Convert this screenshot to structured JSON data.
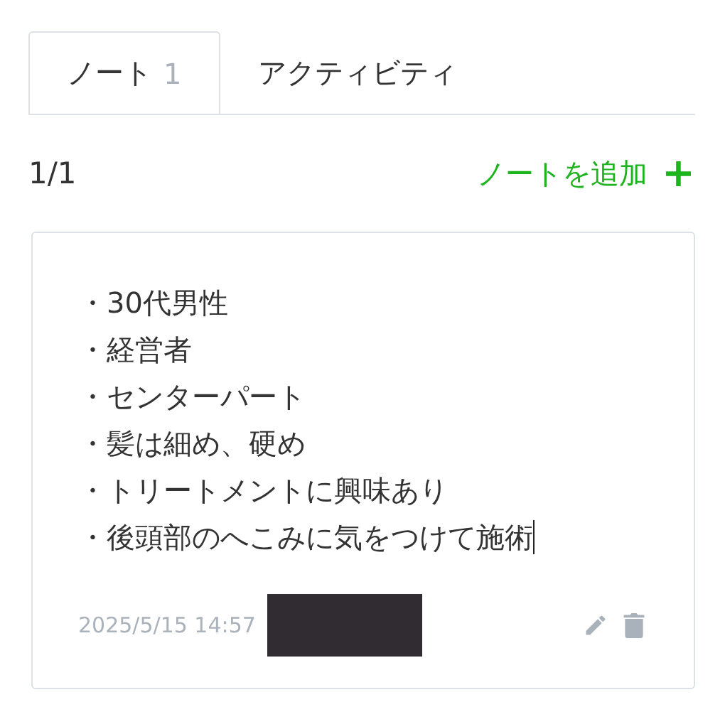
{
  "tabs": [
    {
      "label": "ノート",
      "count": "1",
      "selected": true
    },
    {
      "label": "アクティビティ",
      "selected": false
    }
  ],
  "pager": "1/1",
  "add_note": {
    "label": "ノートを追加",
    "icon": "+"
  },
  "note": {
    "lines": [
      "・30代男性",
      "・経営者",
      "・センターパート",
      "・髪は細め、硬め",
      "・トリートメントに興味あり",
      "・後頭部のへこみに気をつけて施術"
    ],
    "editing": true,
    "timestamp": "2025/5/15 14:57",
    "author_redacted": true
  }
}
